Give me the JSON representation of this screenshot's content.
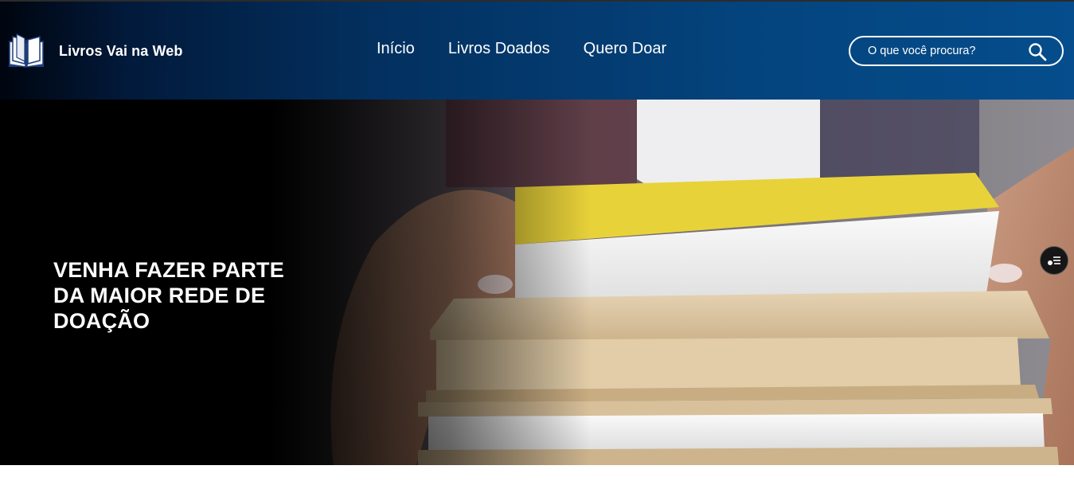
{
  "brand": {
    "name": "Livros Vai na Web",
    "logo_icon": "open-book-icon"
  },
  "nav": {
    "items": [
      {
        "label": "Início"
      },
      {
        "label": "Livros Doados"
      },
      {
        "label": "Quero Doar"
      }
    ]
  },
  "search": {
    "placeholder": "O que você procura?",
    "value": "",
    "icon": "search-icon"
  },
  "hero": {
    "title": "VENHA FAZER PARTE DA MAIOR REDE DE DOAÇÃO",
    "image": "hands-holding-stack-of-books",
    "accessibility_button_icon": "accessibility-menu-icon"
  },
  "colors": {
    "header_dark": "#00050f",
    "header_blue": "#054d8c",
    "hero_left": "#000000",
    "text": "#ffffff",
    "book_yellow": "#e8d23a",
    "book_kraft": "#d9c3a0"
  }
}
